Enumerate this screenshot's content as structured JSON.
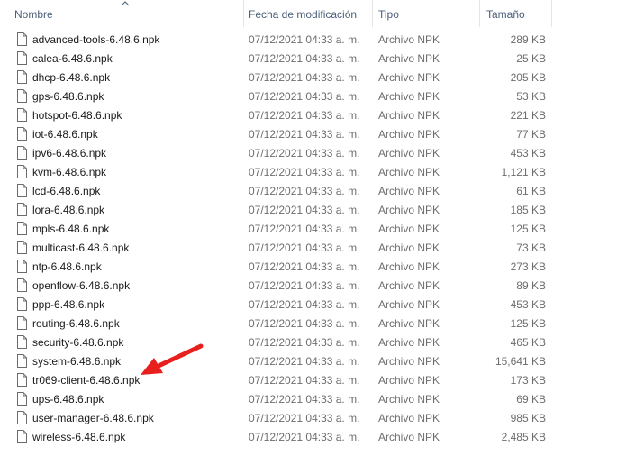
{
  "columns": {
    "name": "Nombre",
    "date": "Fecha de modificación",
    "type": "Tipo",
    "size": "Tamaño"
  },
  "files": [
    {
      "name": "advanced-tools-6.48.6.npk",
      "date": "07/12/2021 04:33 a. m.",
      "type": "Archivo NPK",
      "size": "289 KB"
    },
    {
      "name": "calea-6.48.6.npk",
      "date": "07/12/2021 04:33 a. m.",
      "type": "Archivo NPK",
      "size": "25 KB"
    },
    {
      "name": "dhcp-6.48.6.npk",
      "date": "07/12/2021 04:33 a. m.",
      "type": "Archivo NPK",
      "size": "205 KB"
    },
    {
      "name": "gps-6.48.6.npk",
      "date": "07/12/2021 04:33 a. m.",
      "type": "Archivo NPK",
      "size": "53 KB"
    },
    {
      "name": "hotspot-6.48.6.npk",
      "date": "07/12/2021 04:33 a. m.",
      "type": "Archivo NPK",
      "size": "221 KB"
    },
    {
      "name": "iot-6.48.6.npk",
      "date": "07/12/2021 04:33 a. m.",
      "type": "Archivo NPK",
      "size": "77 KB"
    },
    {
      "name": "ipv6-6.48.6.npk",
      "date": "07/12/2021 04:33 a. m.",
      "type": "Archivo NPK",
      "size": "453 KB"
    },
    {
      "name": "kvm-6.48.6.npk",
      "date": "07/12/2021 04:33 a. m.",
      "type": "Archivo NPK",
      "size": "1,121 KB"
    },
    {
      "name": "lcd-6.48.6.npk",
      "date": "07/12/2021 04:33 a. m.",
      "type": "Archivo NPK",
      "size": "61 KB"
    },
    {
      "name": "lora-6.48.6.npk",
      "date": "07/12/2021 04:33 a. m.",
      "type": "Archivo NPK",
      "size": "185 KB"
    },
    {
      "name": "mpls-6.48.6.npk",
      "date": "07/12/2021 04:33 a. m.",
      "type": "Archivo NPK",
      "size": "125 KB"
    },
    {
      "name": "multicast-6.48.6.npk",
      "date": "07/12/2021 04:33 a. m.",
      "type": "Archivo NPK",
      "size": "73 KB"
    },
    {
      "name": "ntp-6.48.6.npk",
      "date": "07/12/2021 04:33 a. m.",
      "type": "Archivo NPK",
      "size": "273 KB"
    },
    {
      "name": "openflow-6.48.6.npk",
      "date": "07/12/2021 04:33 a. m.",
      "type": "Archivo NPK",
      "size": "89 KB"
    },
    {
      "name": "ppp-6.48.6.npk",
      "date": "07/12/2021 04:33 a. m.",
      "type": "Archivo NPK",
      "size": "453 KB"
    },
    {
      "name": "routing-6.48.6.npk",
      "date": "07/12/2021 04:33 a. m.",
      "type": "Archivo NPK",
      "size": "125 KB"
    },
    {
      "name": "security-6.48.6.npk",
      "date": "07/12/2021 04:33 a. m.",
      "type": "Archivo NPK",
      "size": "465 KB"
    },
    {
      "name": "system-6.48.6.npk",
      "date": "07/12/2021 04:33 a. m.",
      "type": "Archivo NPK",
      "size": "15,641 KB"
    },
    {
      "name": "tr069-client-6.48.6.npk",
      "date": "07/12/2021 04:33 a. m.",
      "type": "Archivo NPK",
      "size": "173 KB"
    },
    {
      "name": "ups-6.48.6.npk",
      "date": "07/12/2021 04:33 a. m.",
      "type": "Archivo NPK",
      "size": "69 KB"
    },
    {
      "name": "user-manager-6.48.6.npk",
      "date": "07/12/2021 04:33 a. m.",
      "type": "Archivo NPK",
      "size": "985 KB"
    },
    {
      "name": "wireless-6.48.6.npk",
      "date": "07/12/2021 04:33 a. m.",
      "type": "Archivo NPK",
      "size": "2,485 KB"
    }
  ],
  "sort": {
    "column": "name",
    "direction": "ascending",
    "icon": "sort-ascending-icon"
  },
  "icons": {
    "file": "document-icon",
    "annotation": "red-arrow-icon"
  },
  "colors": {
    "header_text": "#4c607a",
    "secondary_text": "#6d6d6d",
    "annotation_arrow": "#e8201d"
  }
}
